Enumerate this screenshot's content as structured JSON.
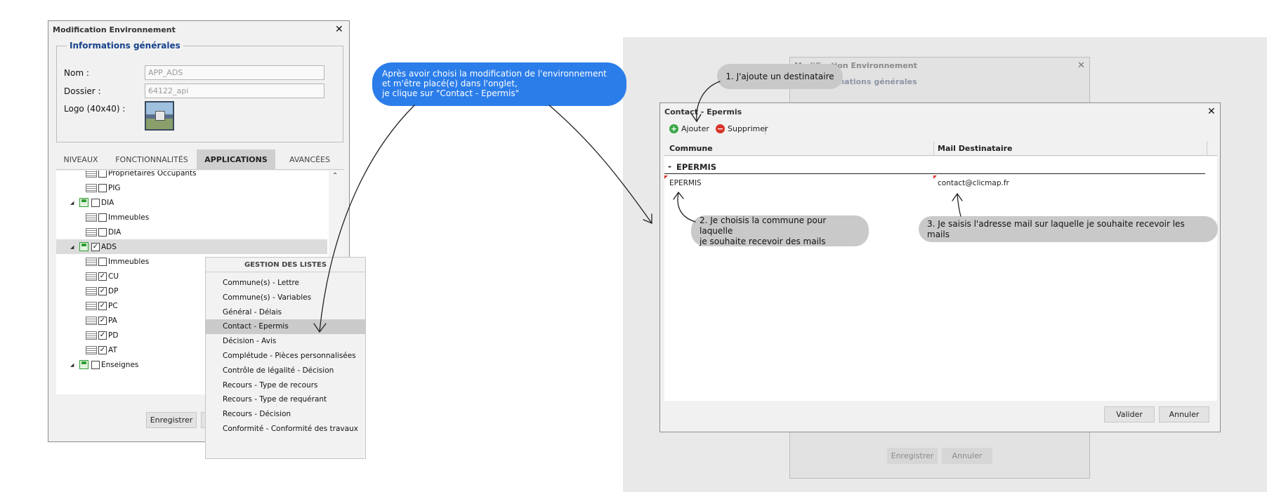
{
  "left_window": {
    "title": "Modification Environnement",
    "fieldset_legend": "Informations générales",
    "nom_label": "Nom :",
    "nom_value": "APP_ADS",
    "dossier_label": "Dossier :",
    "dossier_value": "64122_api",
    "logo_label": "Logo (40x40) :",
    "tabs": [
      {
        "label": "NIVEAUX"
      },
      {
        "label": "FONCTIONNALITÉS"
      },
      {
        "label": "APPLICATIONS"
      },
      {
        "label": "AVANCÉES"
      }
    ],
    "tree": [
      {
        "label": "Propriétaires Occupants",
        "kind": "leaf",
        "checked": false
      },
      {
        "label": "PIG",
        "kind": "leaf",
        "checked": false
      },
      {
        "label": "DIA",
        "kind": "group",
        "checked": false
      },
      {
        "label": "Immeubles",
        "kind": "leaf",
        "checked": false
      },
      {
        "label": "DIA",
        "kind": "leaf",
        "checked": false
      },
      {
        "label": "ADS",
        "kind": "group",
        "checked": true
      },
      {
        "label": "Immeubles",
        "kind": "leaf",
        "checked": false
      },
      {
        "label": "CU",
        "kind": "leaf",
        "checked": true
      },
      {
        "label": "DP",
        "kind": "leaf",
        "checked": true
      },
      {
        "label": "PC",
        "kind": "leaf",
        "checked": true
      },
      {
        "label": "PA",
        "kind": "leaf",
        "checked": true
      },
      {
        "label": "PD",
        "kind": "leaf",
        "checked": true
      },
      {
        "label": "AT",
        "kind": "leaf",
        "checked": true
      },
      {
        "label": "Enseignes",
        "kind": "group",
        "checked": false
      }
    ],
    "save_label": "Enregistrer"
  },
  "context_menu": {
    "title": "GESTION DES LISTES",
    "items": [
      {
        "label": "Commune(s) - Lettre"
      },
      {
        "label": "Commune(s) - Variables"
      },
      {
        "label": "Général - Délais"
      },
      {
        "label": "Contact - Epermis"
      },
      {
        "label": "Décision - Avis"
      },
      {
        "label": "Complétude - Pièces personnalisées"
      },
      {
        "label": "Contrôle de légalité - Décision"
      },
      {
        "label": "Recours - Type de recours"
      },
      {
        "label": "Recours - Type de requérant"
      },
      {
        "label": "Recours - Décision"
      },
      {
        "label": "Conformité - Conformité des travaux"
      }
    ]
  },
  "annotations": {
    "step_intro_line1": "Après avoir choisi la modification de l'environnement",
    "step_intro_line2": "et m'être placé(e) dans l'onglet,",
    "step_intro_line3": "je clique sur \"Contact - Epermis\"",
    "step1": "1. J'ajoute un destinataire",
    "step2_line1": "2. Je choisis la commune pour laquelle",
    "step2_line2": "je souhaite recevoir des mails",
    "step3": "3. Je saisis l'adresse mail sur laquelle je souhaite recevoir les mails"
  },
  "background_window": {
    "title": "Modification Environnement",
    "legend": "Informations générales",
    "save_label": "Enregistrer",
    "cancel_label": "Annuler"
  },
  "contact_dialog": {
    "title": "Contact - Epermis",
    "add_label": "Ajouter",
    "delete_label": "Supprimer",
    "col_commune": "Commune",
    "col_mail": "Mail Destinataire",
    "group_toggle": "-",
    "group_label": "EPERMIS",
    "rows": [
      {
        "commune": "EPERMIS",
        "mail": "contact@clicmap.fr"
      }
    ],
    "validate_label": "Valider",
    "cancel_label": "Annuler"
  },
  "colors": {
    "accent_blue": "#2b7de9",
    "add_green": "#3aa647",
    "delete_red": "#d9342b",
    "annotation_grey": "#c9c9c9"
  }
}
